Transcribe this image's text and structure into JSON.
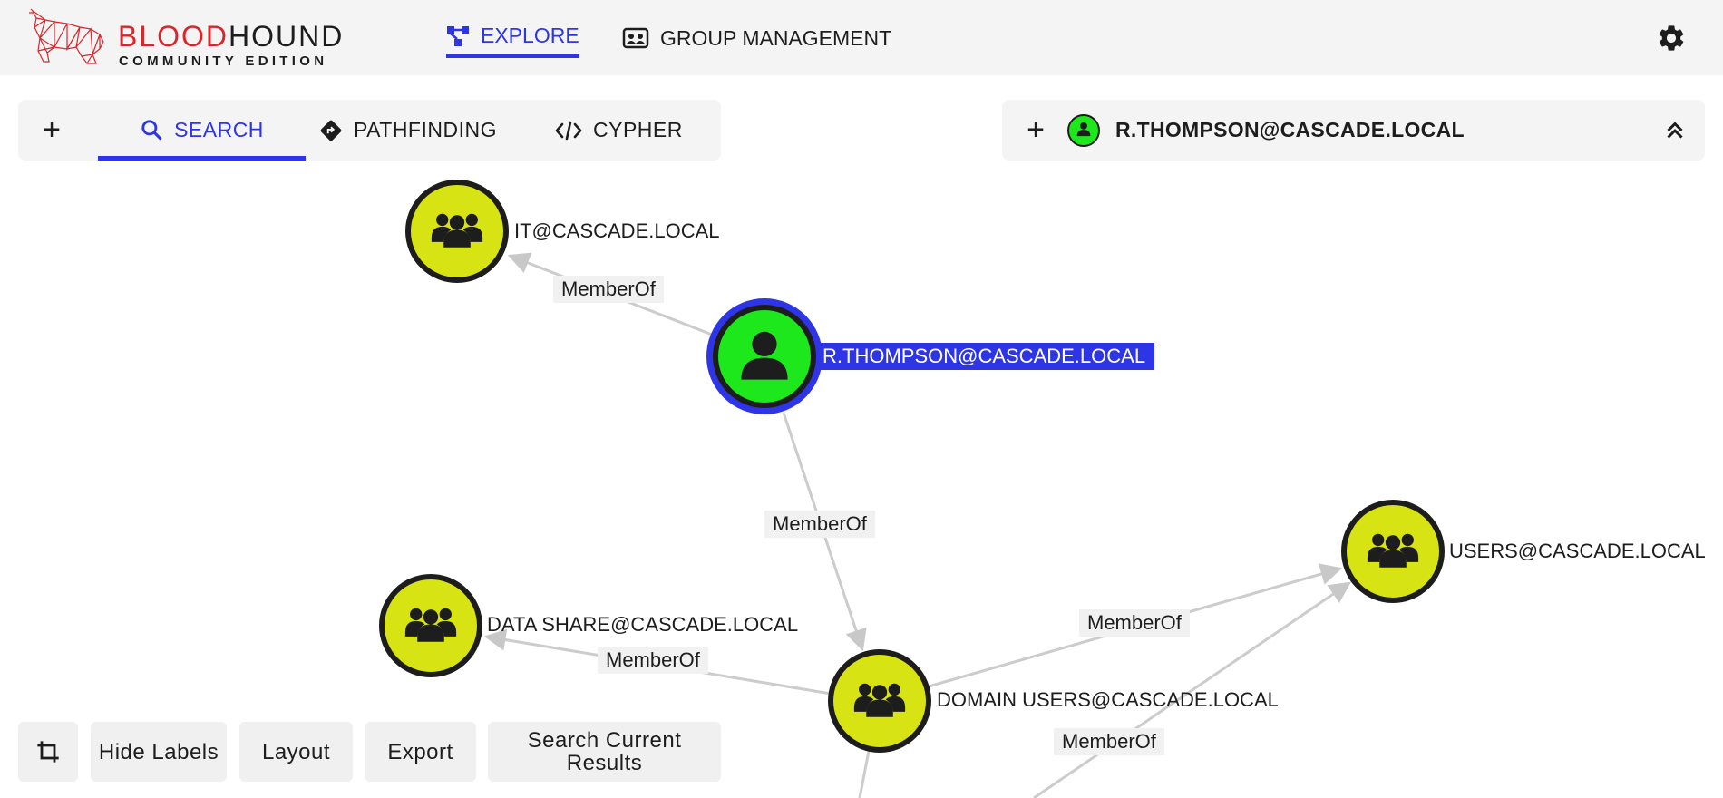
{
  "brand": {
    "name_red": "BLOOD",
    "name_black": "HOUND",
    "edition": "COMMUNITY EDITION",
    "logo_icon": "bloodhound-dog-logo"
  },
  "nav": {
    "explore_label": "EXPLORE",
    "group_label": "GROUP MANAGEMENT",
    "settings_icon": "gear-icon"
  },
  "search_panel": {
    "add_label": "+",
    "tabs": [
      {
        "label": "SEARCH",
        "icon": "search-icon",
        "active": true
      },
      {
        "label": "PATHFINDING",
        "icon": "route-icon",
        "active": false
      },
      {
        "label": "CYPHER",
        "icon": "code-icon",
        "active": false
      }
    ]
  },
  "entity_panel": {
    "add_label": "+",
    "name": "R.THOMPSON@CASCADE.LOCAL",
    "icon": "user-icon",
    "collapse_icon": "chevrons-up-icon"
  },
  "graph": {
    "nodes": [
      {
        "id": "it",
        "label": "IT@CASCADE.LOCAL",
        "kind": "group"
      },
      {
        "id": "rthompson",
        "label": "R.THOMPSON@CASCADE.LOCAL",
        "kind": "user",
        "selected": true
      },
      {
        "id": "users",
        "label": "USERS@CASCADE.LOCAL",
        "kind": "group"
      },
      {
        "id": "datashare",
        "label": "DATA SHARE@CASCADE.LOCAL",
        "kind": "group"
      },
      {
        "id": "domainusers",
        "label": "DOMAIN USERS@CASCADE.LOCAL",
        "kind": "group"
      }
    ],
    "edges": [
      {
        "from": "rthompson",
        "to": "it",
        "label": "MemberOf"
      },
      {
        "from": "rthompson",
        "to": "domainusers",
        "label": "MemberOf"
      },
      {
        "from": "domainusers",
        "to": "users",
        "label": "MemberOf"
      },
      {
        "from": "domainusers",
        "to": "datashare",
        "label": "MemberOf"
      },
      {
        "from": "offscreen",
        "to": "users",
        "label": "MemberOf"
      }
    ],
    "colors": {
      "group": "#d7e313",
      "user": "#1ce81c",
      "selected": "#2e35e6",
      "edge": "#cccccc"
    }
  },
  "controls": {
    "crop_icon": "crop-icon",
    "hide_labels": "Hide Labels",
    "layout": "Layout",
    "export": "Export",
    "search_results": "Search Current Results"
  }
}
